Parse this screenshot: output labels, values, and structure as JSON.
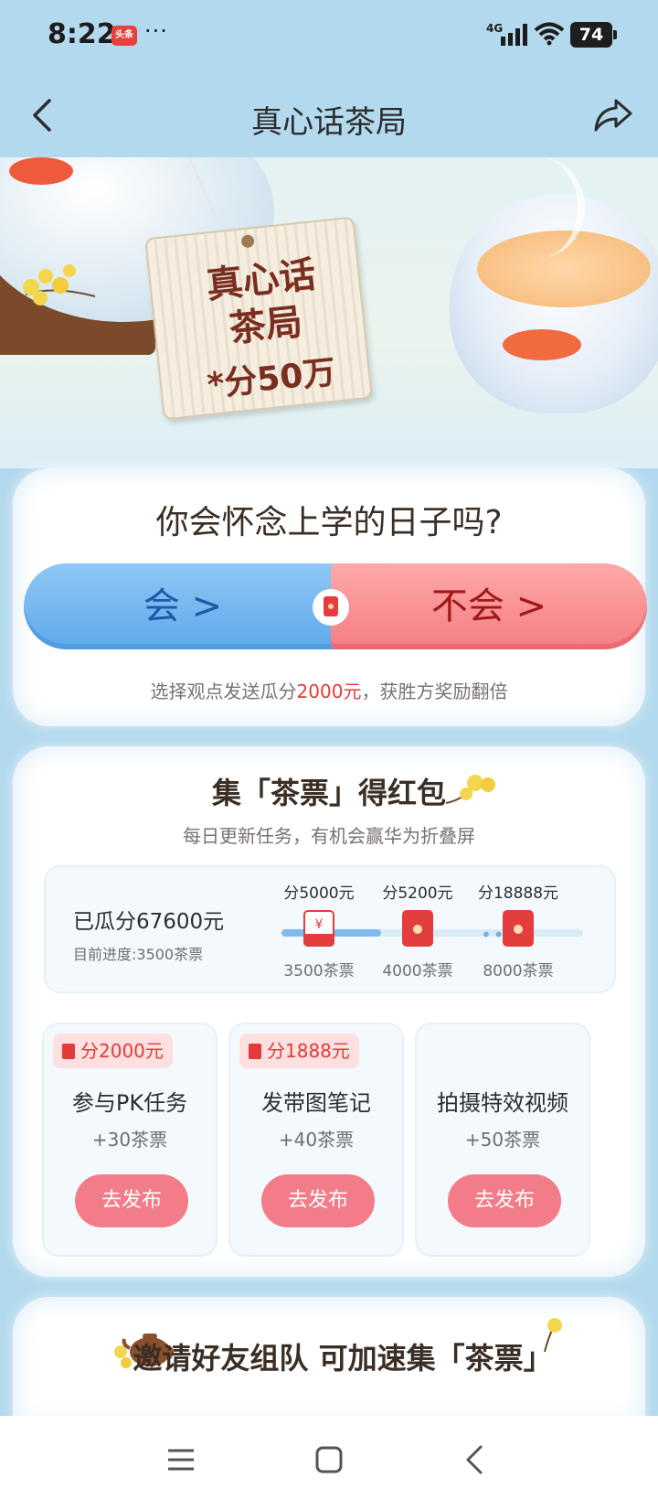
{
  "status_bar": {
    "time": "8:22",
    "app_badge": "头条",
    "more": "···",
    "network": "4G",
    "battery": "74"
  },
  "header": {
    "title": "真心话茶局",
    "back_icon": "chevron-left-icon",
    "share_icon": "share-icon"
  },
  "banner": {
    "tag_line1": "真心话",
    "tag_line2": "茶局",
    "tag_prize": "*分50万"
  },
  "poll": {
    "question": "你会怀念上学的日子吗?",
    "yes_label": "会 >",
    "no_label": "不会 >",
    "hint_prefix": "选择观点发送瓜分",
    "hint_amount": "2000元",
    "hint_suffix": "，获胜方奖励翻倍",
    "colors": {
      "yes": "#5ea9ea",
      "no": "#f47d82",
      "highlight": "#e43c3c"
    }
  },
  "tasks": {
    "title": "集「茶票」得红包",
    "subtitle": "每日更新任务，有机会赢华为折叠屏",
    "progress": {
      "amount_label": "已瓜分67600元",
      "current_label": "目前进度:3500茶票",
      "fill_fraction": 0.33,
      "milestones": [
        {
          "reward": "分5000元",
          "tickets": "3500茶票",
          "reached": true
        },
        {
          "reward": "分5200元",
          "tickets": "4000茶票",
          "reached": false
        },
        {
          "reward": "分18888元",
          "tickets": "8000茶票",
          "reached": false
        }
      ]
    },
    "items": [
      {
        "badge": "分2000元",
        "name": "参与PK任务",
        "points": "+30茶票",
        "button": "去发布"
      },
      {
        "badge": "分1888元",
        "name": "发带图笔记",
        "points": "+40茶票",
        "button": "去发布"
      },
      {
        "badge": "",
        "name": "拍摄特效视频",
        "points": "+50茶票",
        "button": "去发布"
      }
    ]
  },
  "invite": {
    "title": "邀请好友组队 可加速集「茶票」"
  },
  "navbar": {
    "menu_icon": "menu-icon",
    "home_icon": "home-square-icon",
    "back_icon": "back-triangle-icon"
  }
}
